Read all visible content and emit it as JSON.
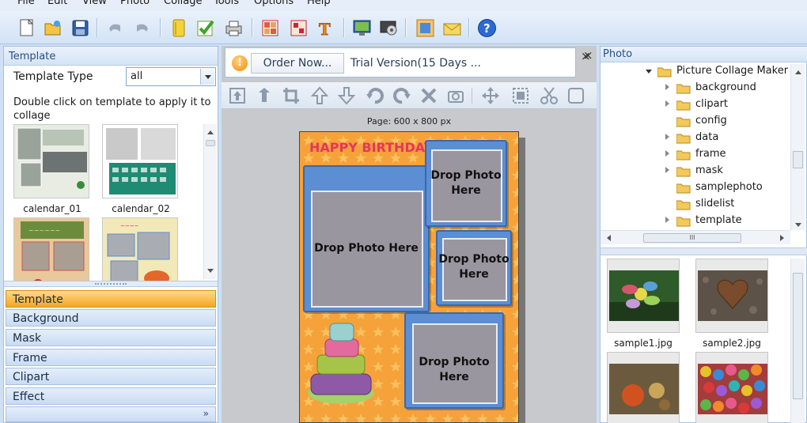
{
  "menu": [
    "File",
    "Edit",
    "View",
    "Photo",
    "Collage",
    "Tools",
    "Options",
    "Help"
  ],
  "left_panel": {
    "header": "Template",
    "template_type_label": "Template Type",
    "template_type_value": "all",
    "hint": "Double click on template to apply it to collage",
    "thumbnails": [
      {
        "label": "calendar_01"
      },
      {
        "label": "calendar_02"
      },
      {
        "label": ""
      },
      {
        "label": ""
      }
    ],
    "categories": [
      "Template",
      "Background",
      "Mask",
      "Frame",
      "Clipart",
      "Effect"
    ],
    "active_category": "Template",
    "expand_glyph": "»"
  },
  "center": {
    "info_icon": "!",
    "order_button": "Order Now...",
    "trial_text": "Trial Version(15 Days ...",
    "close_glyph": "×",
    "page_size": "Page: 600 x 800 px",
    "canvas": {
      "title": "HAPPY BIRTHDAY",
      "drop_labels": [
        "Drop Photo Here",
        "Drop Photo Here",
        "Drop Photo Here",
        "Drop Photo Here"
      ]
    }
  },
  "right_panel": {
    "header": "Photo",
    "close_glyph": "×",
    "tree_root": "Picture Collage Maker",
    "tree_items": [
      {
        "name": "background",
        "expandable": true
      },
      {
        "name": "clipart",
        "expandable": true
      },
      {
        "name": "config",
        "expandable": false
      },
      {
        "name": "data",
        "expandable": true
      },
      {
        "name": "frame",
        "expandable": true
      },
      {
        "name": "mask",
        "expandable": true
      },
      {
        "name": "samplephoto",
        "expandable": false
      },
      {
        "name": "slidelist",
        "expandable": false
      },
      {
        "name": "template",
        "expandable": true
      }
    ],
    "scroll_glyph": "III",
    "photos": [
      {
        "label": "sample1.jpg"
      },
      {
        "label": "sample2.jpg"
      },
      {
        "label": ""
      },
      {
        "label": ""
      }
    ]
  },
  "colors": {
    "accent": "#f5a623",
    "panel_blue": "#cfe0f4",
    "frame_blue": "#5b8ed2"
  }
}
